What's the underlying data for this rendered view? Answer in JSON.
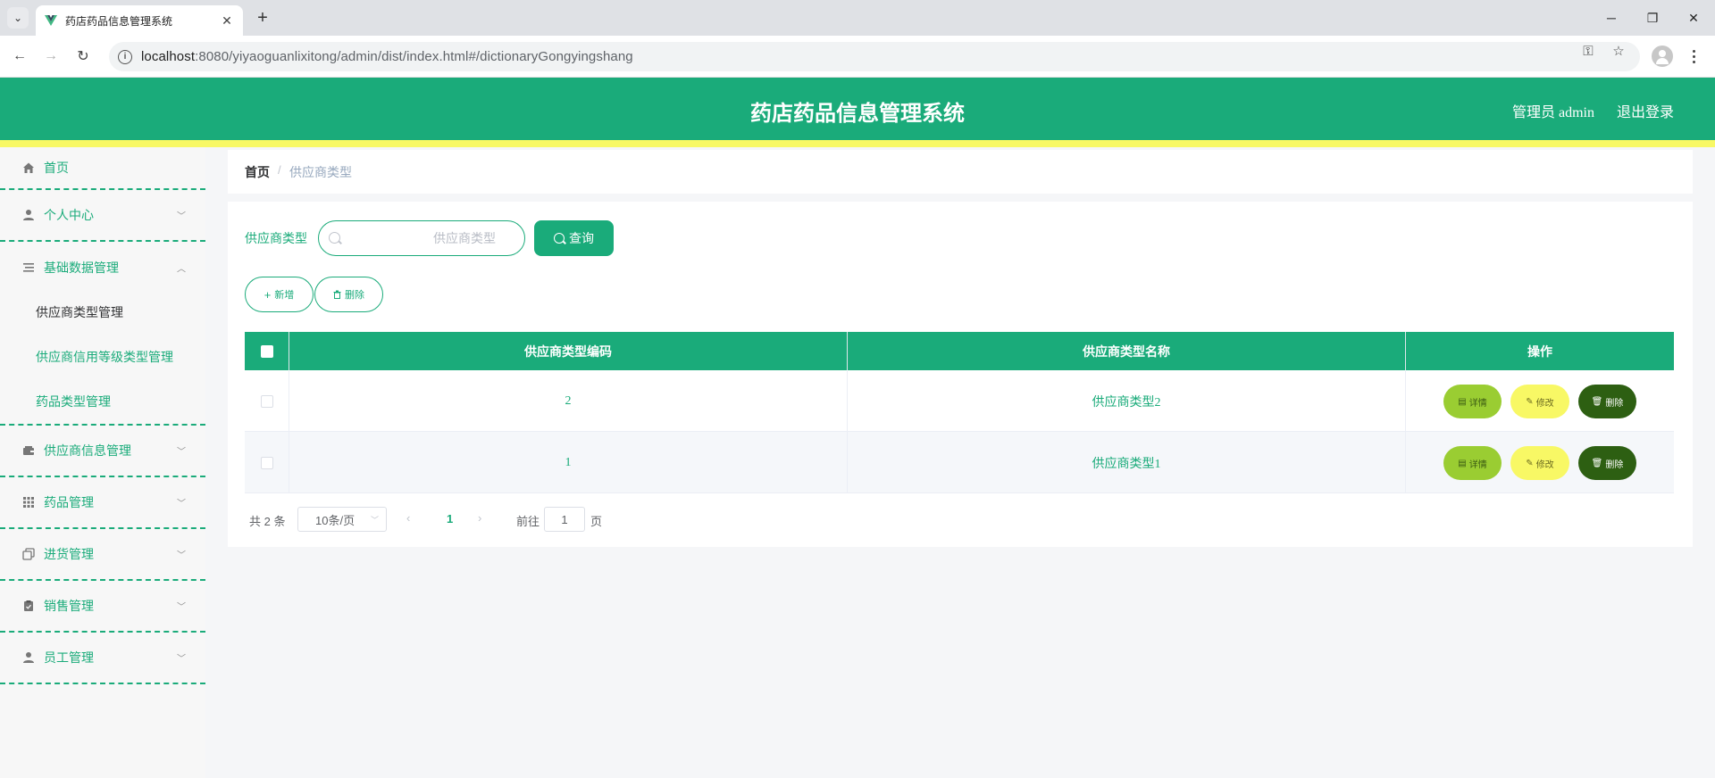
{
  "browser": {
    "tab_title": "药店药品信息管理系统",
    "url_host": "localhost",
    "url_rest": ":8080/yiyaoguanlixitong/admin/dist/index.html#/dictionaryGongyingshang"
  },
  "header": {
    "title": "药店药品信息管理系统",
    "user": "管理员 admin",
    "logout": "退出登录"
  },
  "sidebar": {
    "items": [
      {
        "label": "首页",
        "icon": "home-icon"
      },
      {
        "label": "个人中心",
        "icon": "user-icon"
      },
      {
        "label": "基础数据管理",
        "icon": "list-icon"
      },
      {
        "label": "供应商信息管理",
        "icon": "wallet-icon"
      },
      {
        "label": "药品管理",
        "icon": "grid-icon"
      },
      {
        "label": "进货管理",
        "icon": "copy-icon"
      },
      {
        "label": "销售管理",
        "icon": "clipboard-icon"
      },
      {
        "label": "员工管理",
        "icon": "user-icon"
      }
    ],
    "subitems": [
      {
        "label": "供应商类型管理"
      },
      {
        "label": "供应商信用等级类型管理"
      },
      {
        "label": "药品类型管理"
      }
    ]
  },
  "breadcrumb": {
    "home": "首页",
    "separator": "/",
    "current": "供应商类型"
  },
  "search": {
    "label": "供应商类型",
    "placeholder": "供应商类型",
    "button": "查询"
  },
  "actions": {
    "add": "新增",
    "delete": "删除"
  },
  "table": {
    "columns": [
      "供应商类型编码",
      "供应商类型名称",
      "操作"
    ],
    "rows": [
      {
        "code": "2",
        "name": "供应商类型2"
      },
      {
        "code": "1",
        "name": "供应商类型1"
      }
    ],
    "row_actions": {
      "detail": "详情",
      "edit": "修改",
      "delete": "删除"
    }
  },
  "pagination": {
    "total": "共 2 条",
    "page_size": "10条/页",
    "current_page": "1",
    "goto_label": "前往",
    "goto_value": "1",
    "page_suffix": "页"
  },
  "colors": {
    "primary": "#1aab7a",
    "accent_stripe": "#f8f865",
    "detail_btn": "#9acd32",
    "edit_btn": "#f8f865",
    "delete_btn": "#2d5f12"
  }
}
